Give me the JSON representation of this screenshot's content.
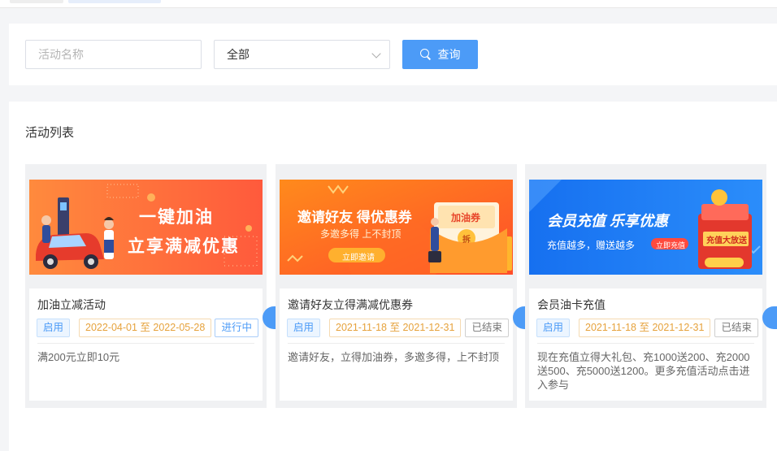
{
  "search": {
    "name_placeholder": "活动名称",
    "status_selected": "全部",
    "query_label": "查询"
  },
  "list": {
    "title": "活动列表",
    "cards": [
      {
        "banner_line1": "一键加油",
        "banner_line2": "立享满减优惠",
        "title": "加油立减活动",
        "enabled_label": "启用",
        "date_range": "2022-04-01 至 2022-05-28",
        "status": "进行中",
        "desc": "满200元立即10元"
      },
      {
        "banner_line1": "邀请好友 得优惠券",
        "banner_line2": "多邀多得 上不封顶",
        "banner_button": "立即邀请",
        "banner_card_text": "加油券",
        "banner_coin_text": "拆",
        "title": "邀请好友立得满减优惠券",
        "enabled_label": "启用",
        "date_range": "2021-11-18 至 2021-12-31",
        "status": "已结束",
        "desc": "邀请好友，立得加油券，多邀多得，上不封顶"
      },
      {
        "banner_line1": "会员充值  乐享优惠",
        "banner_line2": "充值越多，赠送越多",
        "banner_button": "立即充值",
        "banner_box_text": "充值大放送",
        "title": "会员油卡充值",
        "enabled_label": "启用",
        "date_range": "2021-11-18 至 2021-12-31",
        "status": "已结束",
        "desc": "现在充值立得大礼包、充1000送200、充2000送500、充5000送1200。更多充值活动点击进入参与"
      }
    ]
  },
  "colors": {
    "primary": "#4c9bf7",
    "date_tag": "#e6a23c",
    "banner1": "#ff6a3a",
    "banner2": "#ff7a1f",
    "banner3": "#1f7cf5"
  }
}
